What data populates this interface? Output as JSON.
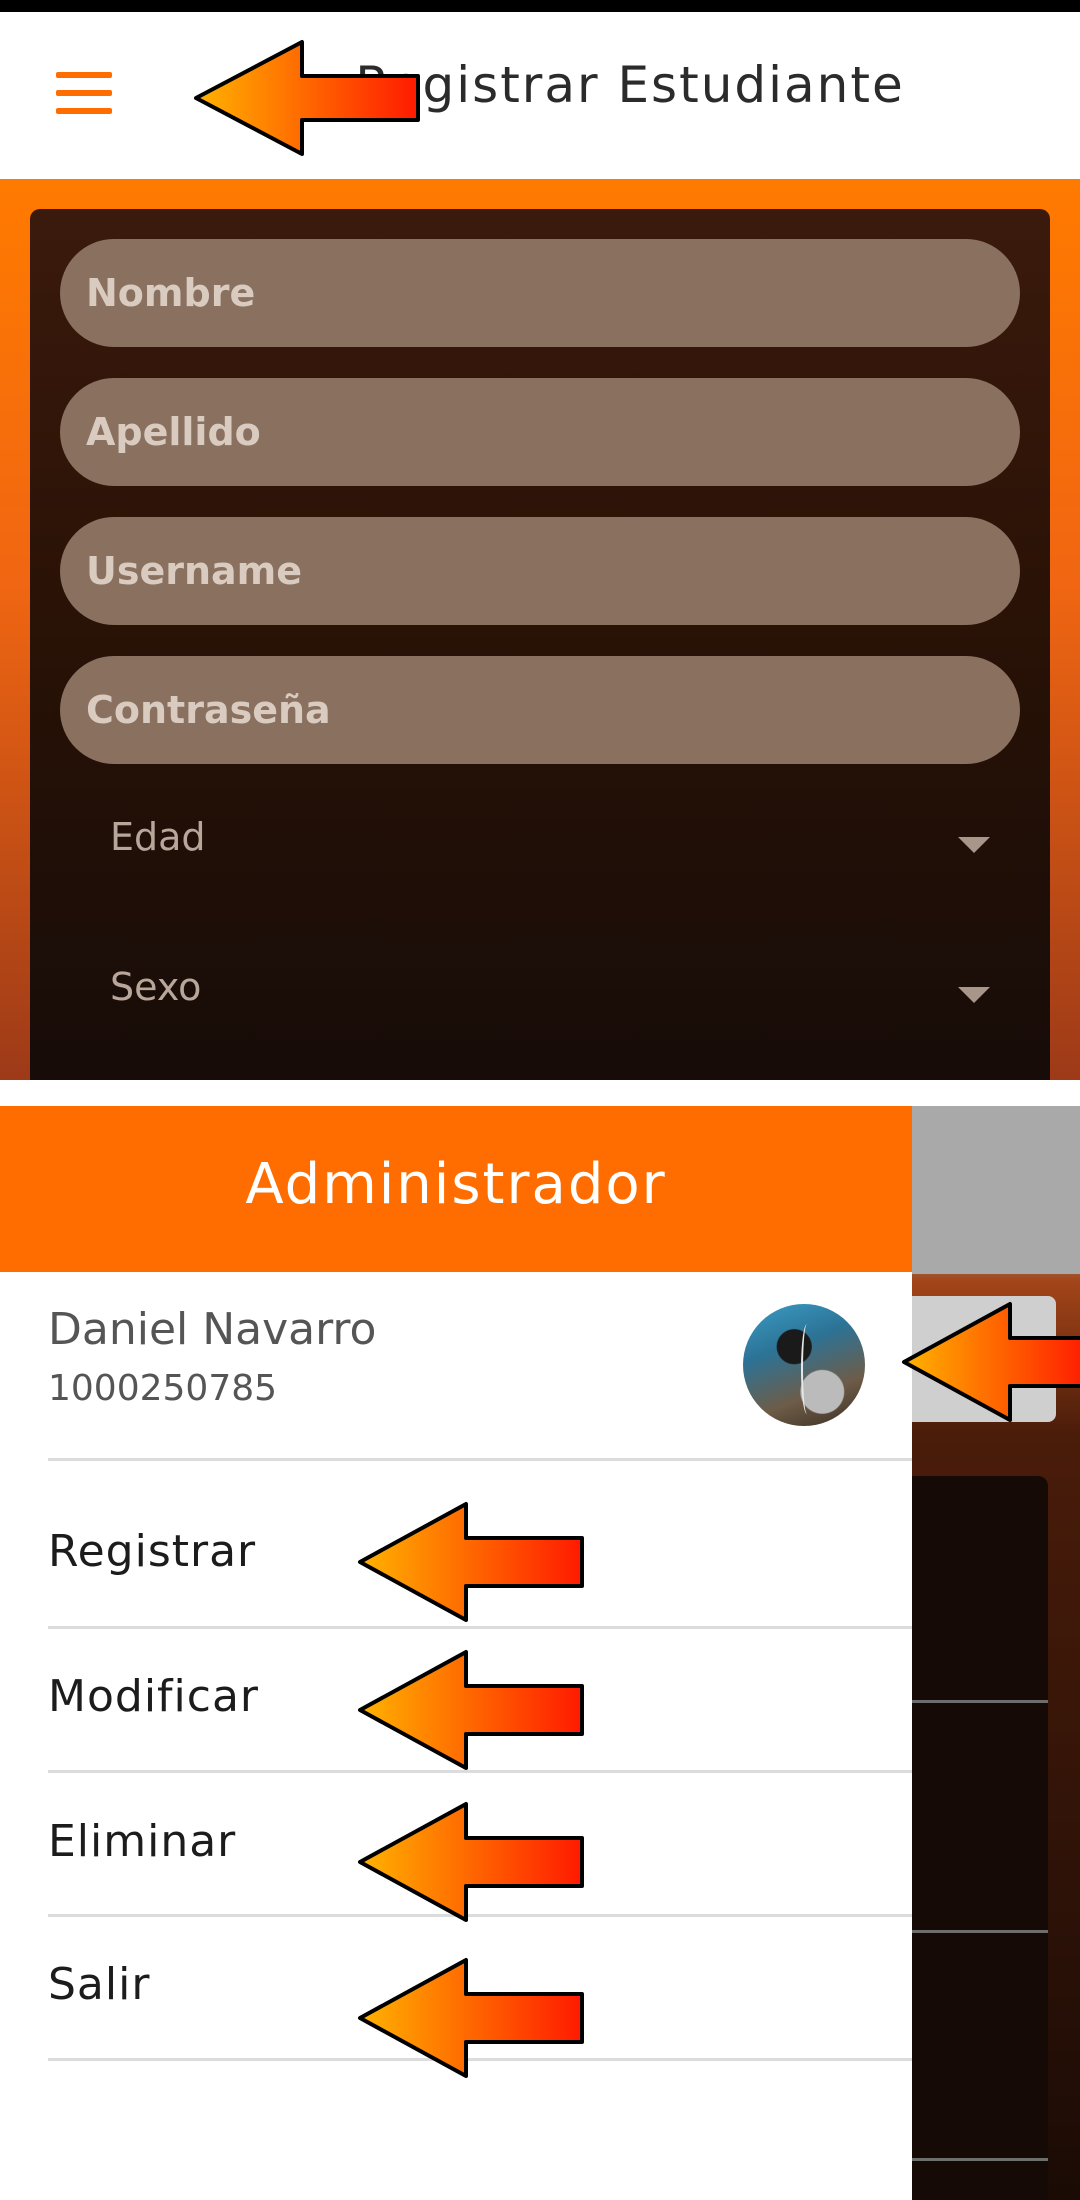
{
  "appbar": {
    "title": "Registrar Estudiante"
  },
  "form": {
    "fields": [
      {
        "placeholder": "Nombre"
      },
      {
        "placeholder": "Apellido"
      },
      {
        "placeholder": "Username"
      },
      {
        "placeholder": "Contraseña"
      }
    ],
    "selects": [
      {
        "label": "Edad"
      },
      {
        "label": "Sexo"
      }
    ]
  },
  "drawer": {
    "role": "Administrador",
    "user": {
      "name": "Daniel Navarro",
      "id": "1000250785"
    },
    "menu": [
      {
        "label": "Registrar"
      },
      {
        "label": "Modificar"
      },
      {
        "label": "Eliminar"
      },
      {
        "label": "Salir"
      }
    ]
  },
  "colors": {
    "accent": "#ff6d00",
    "arrow_start": "#ffb300",
    "arrow_end": "#ff1a00"
  }
}
